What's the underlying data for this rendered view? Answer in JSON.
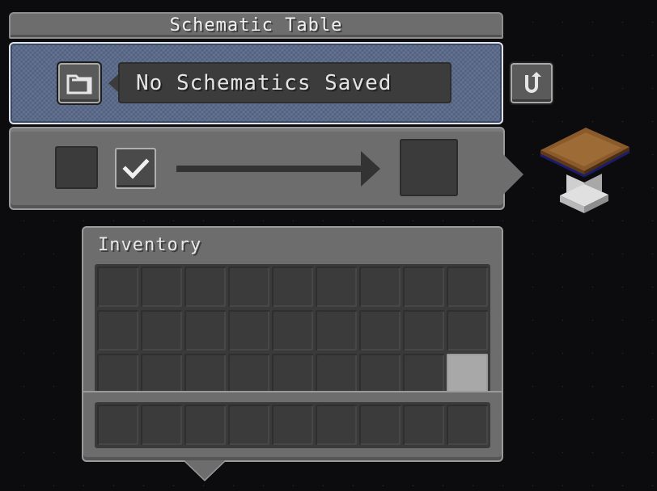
{
  "window": {
    "title": "Schematic Table"
  },
  "schematic": {
    "selected_name": "No Schematics Saved"
  },
  "icons": {
    "folder": "folder-icon",
    "refresh": "refresh-icon",
    "check": "checkmark-icon",
    "arrow": "right-arrow-icon",
    "block": "schematic-table-block-icon"
  },
  "crafting": {
    "confirm_checked": true
  },
  "inventory": {
    "title": "Inventory",
    "rows": 3,
    "columns": 9,
    "highlighted_slot": {
      "row": 3,
      "column": 9
    }
  },
  "colors": {
    "panel": "#6d6d6d",
    "schematic_panel": "#5b6b8c",
    "slot": "#3b3b3b",
    "highlight": "#a8a8a8"
  }
}
